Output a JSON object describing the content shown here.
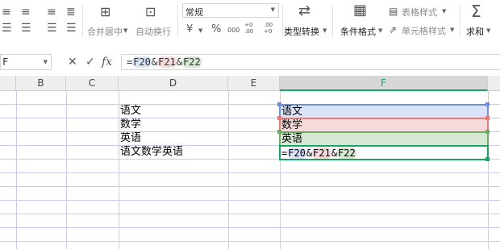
{
  "ribbon": {
    "merge_center_label": "合并居中",
    "auto_wrap_label": "自动换行",
    "number_format_value": "常规",
    "currency_symbol": "¥",
    "percent_symbol": "%",
    "thousands_symbol": "000",
    "inc_decimal_symbol": "+0 .00",
    "dec_decimal_symbol": ".00 +0",
    "type_convert_label": "类型转换",
    "cond_format_label": "条件格式",
    "table_style_label": "表格样式",
    "cell_style_label": "单元格样式",
    "sum_label": "求和"
  },
  "formula_bar": {
    "name_box_value": "F",
    "cancel_icon": "✕",
    "confirm_icon": "✓",
    "fx_label": "fx",
    "formula": {
      "prefix": "=",
      "ref1": "F20",
      "amp1": "&",
      "ref2": "F21",
      "amp2": "&",
      "ref3": "F22"
    }
  },
  "grid": {
    "columns": [
      "B",
      "C",
      "D",
      "E",
      "F"
    ],
    "d_cells": [
      "语文",
      "数学",
      "英语",
      "语文数学英语"
    ],
    "f_cells": [
      "语文",
      "数学",
      "英语"
    ],
    "f_edit": {
      "prefix": "=",
      "ref1": "F20",
      "amp1": "&",
      "ref2": "F21",
      "amp2": "&",
      "ref3": "F22"
    }
  },
  "colors": {
    "accent_green": "#1aa260",
    "ref_blue": "#dbe3f8",
    "ref_red": "#f6dada",
    "ref_green": "#d6e8d2"
  }
}
